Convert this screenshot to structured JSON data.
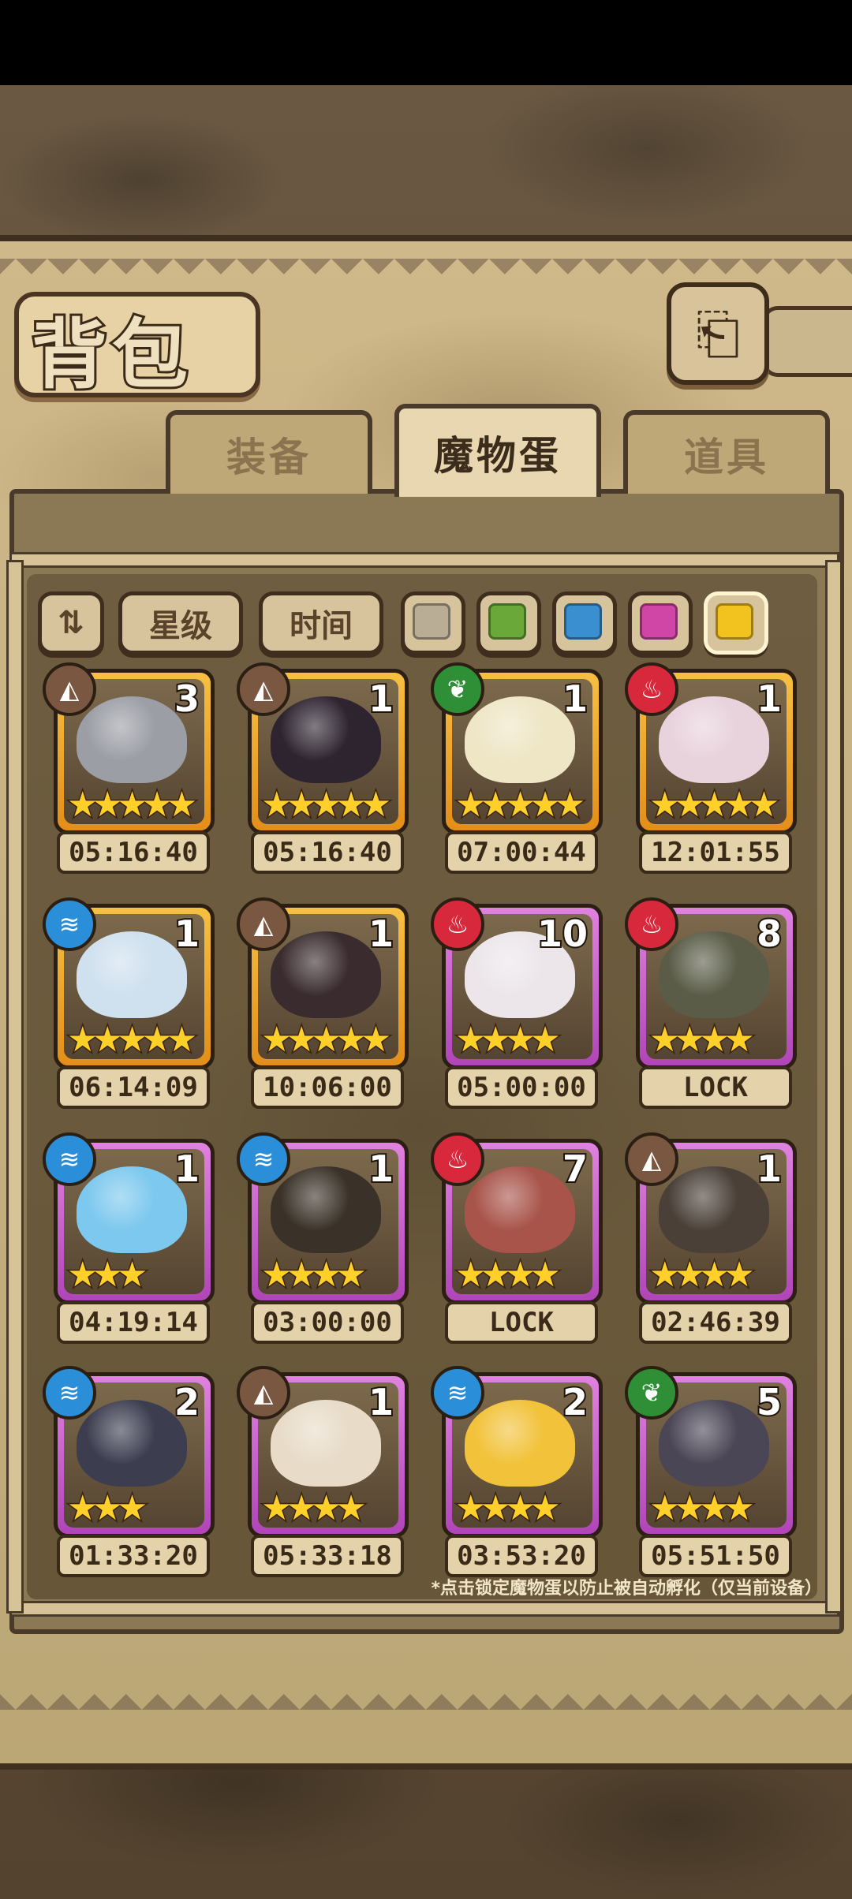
{
  "page_title": "背包",
  "back_icon": "⎗",
  "tabs": [
    {
      "label": "装备",
      "active": false
    },
    {
      "label": "魔物蛋",
      "active": true
    },
    {
      "label": "道具",
      "active": false
    }
  ],
  "filters": {
    "sort_icon": "⇅",
    "star_label": "星级",
    "time_label": "时间",
    "swatches": [
      "#b9ad96",
      "#6aa83a",
      "#3a8fd0",
      "#d046a6",
      "#f2c21f"
    ]
  },
  "eggs": [
    {
      "count": "3",
      "stars": "★★★★★",
      "time": "05:16:40",
      "element": "earth",
      "rarity": "gold",
      "art": "#9c9ea6"
    },
    {
      "count": "1",
      "stars": "★★★★★",
      "time": "05:16:40",
      "element": "earth",
      "rarity": "gold",
      "art": "#2e2430"
    },
    {
      "count": "1",
      "stars": "★★★★★",
      "time": "07:00:44",
      "element": "plant",
      "rarity": "gold",
      "art": "#efe6c6"
    },
    {
      "count": "1",
      "stars": "★★★★★",
      "time": "12:01:55",
      "element": "fire",
      "rarity": "gold",
      "art": "#e8d2dc"
    },
    {
      "count": "1",
      "stars": "★★★★★",
      "time": "06:14:09",
      "element": "water",
      "rarity": "gold",
      "art": "#cfe0ee"
    },
    {
      "count": "1",
      "stars": "★★★★★",
      "time": "10:06:00",
      "element": "earth",
      "rarity": "gold",
      "art": "#3a2c2e"
    },
    {
      "count": "10",
      "stars": "★★★★",
      "time": "05:00:00",
      "element": "fire",
      "rarity": "purple",
      "art": "#ece6ea"
    },
    {
      "count": "8",
      "stars": "★★★★",
      "time": "LOCK",
      "element": "fire",
      "rarity": "purple",
      "art": "#5a5c48"
    },
    {
      "count": "1",
      "stars": "★★★",
      "time": "04:19:14",
      "element": "water",
      "rarity": "purple",
      "art": "#7cc8ee"
    },
    {
      "count": "1",
      "stars": "★★★★",
      "time": "03:00:00",
      "element": "water",
      "rarity": "purple",
      "art": "#3a3228"
    },
    {
      "count": "7",
      "stars": "★★★★",
      "time": "LOCK",
      "element": "fire",
      "rarity": "purple",
      "art": "#a8544a"
    },
    {
      "count": "1",
      "stars": "★★★★",
      "time": "02:46:39",
      "element": "earth",
      "rarity": "purple",
      "art": "#4a4038"
    },
    {
      "count": "2",
      "stars": "★★★",
      "time": "01:33:20",
      "element": "water",
      "rarity": "purple",
      "art": "#3c3e50"
    },
    {
      "count": "1",
      "stars": "★★★★",
      "time": "05:33:18",
      "element": "earth",
      "rarity": "purple",
      "art": "#e8dcc8"
    },
    {
      "count": "2",
      "stars": "★★★★",
      "time": "03:53:20",
      "element": "water",
      "rarity": "purple",
      "art": "#f2c23a"
    },
    {
      "count": "5",
      "stars": "★★★★",
      "time": "05:51:50",
      "element": "plant",
      "rarity": "purple",
      "art": "#4a4656"
    }
  ],
  "element_icons": {
    "earth": "◭",
    "water": "≋",
    "fire": "♨",
    "plant": "❦"
  },
  "footnote": "*点击锁定魔物蛋以防止被自动孵化（仅当前设备）"
}
